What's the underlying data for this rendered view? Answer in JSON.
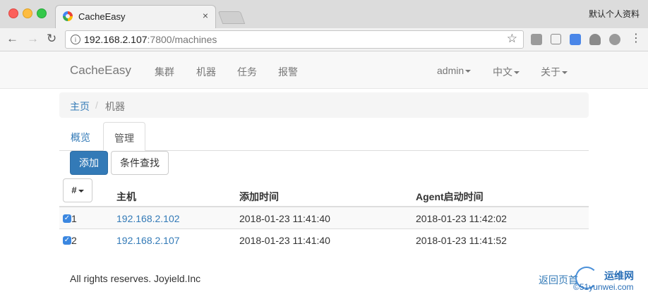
{
  "browser": {
    "tab_title": "CacheEasy",
    "tab_close": "×",
    "profile": "默认个人资料",
    "url_host": "192.168.2.107",
    "url_path": ":7800/machines",
    "back_icon": "arrow-left-icon",
    "forward_icon": "arrow-right-icon",
    "reload_icon": "reload-icon"
  },
  "navbar": {
    "brand": "CacheEasy",
    "links": [
      "集群",
      "机器",
      "任务",
      "报警"
    ],
    "user": "admin",
    "language": "中文",
    "about": "关于"
  },
  "breadcrumb": {
    "home": "主页",
    "separator": "/",
    "current": "机器"
  },
  "tabs": {
    "overview": "概览",
    "manage": "管理"
  },
  "actions": {
    "add": "添加",
    "search": "条件查找"
  },
  "table": {
    "column_toggle": "#",
    "headers": [
      "主机",
      "添加时间",
      "Agent启动时间"
    ],
    "rows": [
      {
        "index": "1",
        "host": "192.168.2.102",
        "added": "2018-01-23 11:41:40",
        "agent_start": "2018-01-23 11:42:02",
        "checked": true
      },
      {
        "index": "2",
        "host": "192.168.2.107",
        "added": "2018-01-23 11:41:40",
        "agent_start": "2018-01-23 11:41:52",
        "checked": true
      }
    ]
  },
  "footer": {
    "copyright": "All rights reserves. Joyield.Inc",
    "back_to_top": "返回页首"
  },
  "watermark": {
    "title": "运维网",
    "subtitle": "©51yunwei.com"
  },
  "colors": {
    "primary": "#337ab7",
    "navbar_bg": "#f8f8f8",
    "breadcrumb_bg": "#f5f5f5"
  }
}
